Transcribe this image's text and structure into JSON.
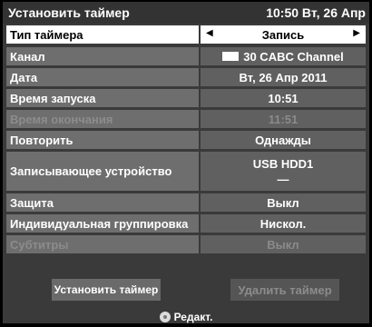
{
  "header": {
    "title": "Установить таймер",
    "clock": "10:50 Вт, 26 Апр"
  },
  "rows": [
    {
      "label": "Тип таймера",
      "value": "Запись"
    },
    {
      "label": "Канал",
      "value": "30 CABC Channel"
    },
    {
      "label": "Дата",
      "value": "Вт, 26 Апр 2011"
    },
    {
      "label": "Время запуска",
      "value": "10:51"
    },
    {
      "label": "Время окончания",
      "value": "11:51"
    },
    {
      "label": "Повторить",
      "value": "Однажды"
    },
    {
      "label": "Записывающее устройство",
      "value": "USB HDD1",
      "value2": "—"
    },
    {
      "label": "Защита",
      "value": "Выкл"
    },
    {
      "label": "Индивидуальная группировка",
      "value": "Нискол."
    },
    {
      "label": "Субтитры",
      "value": "Выкл"
    }
  ],
  "buttons": {
    "set": "Установить таймер",
    "delete": "Удалить таймер"
  },
  "footer": {
    "hint": "Редакт.",
    "icon": "dpad-icon"
  },
  "colors": {
    "focus_bg": "#ffffff",
    "label_bg": "#6e6e6e",
    "value_bg": "#606060",
    "screen_bg": "#3a3a3a"
  }
}
